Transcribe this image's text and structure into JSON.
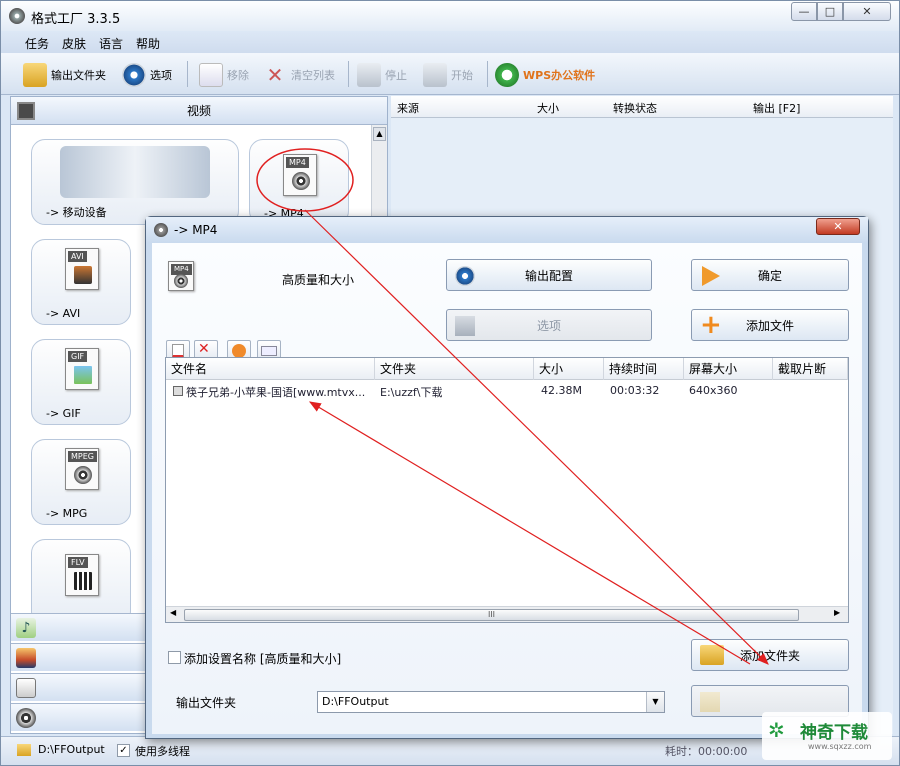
{
  "app": {
    "title": "格式工厂 3.3.5",
    "controls": {
      "minimize": "—",
      "maximize": "□",
      "close": "✕"
    }
  },
  "menu": [
    "任务",
    "皮肤",
    "语言",
    "帮助"
  ],
  "toolbar": {
    "output_folder": "输出文件夹",
    "options": "选项",
    "remove": "移除",
    "clear_list": "清空列表",
    "stop": "停止",
    "start": "开始",
    "wps": "WPS办公软件"
  },
  "sidebar": {
    "category": "视频",
    "tiles": [
      {
        "label": "-> 移动设备",
        "icon": "mobile-devices-icon"
      },
      {
        "label": "-> MP4",
        "tag": "MP4"
      },
      {
        "label": "-> AVI",
        "tag": "AVI"
      },
      {
        "label": "-> GIF",
        "tag": "GIF"
      },
      {
        "label": "-> MPG",
        "tag": "MPEG"
      },
      {
        "label": "",
        "tag": "FLV"
      }
    ],
    "other_categories": [
      "music-note-icon",
      "picture-icon",
      "optical-disc-icon",
      "film-reel-icon"
    ]
  },
  "task_table": {
    "columns": [
      "来源",
      "大小",
      "转换状态",
      "输出 [F2]"
    ]
  },
  "statusbar": {
    "output_path": "D:\\FFOutput",
    "multithread_label": "使用多线程",
    "multithread_checked": true,
    "elapsed_label": "耗时：00:00:00"
  },
  "dialog": {
    "title": "-> MP4",
    "quality": "高质量和大小",
    "output_config": "输出配置",
    "ok": "确定",
    "options": "选项",
    "add_file": "添加文件",
    "add_folder": "添加文件夹",
    "columns": [
      "文件名",
      "文件夹",
      "大小",
      "持续时间",
      "屏幕大小",
      "截取片断"
    ],
    "rows": [
      {
        "name": "筷子兄弟-小苹果-国语[www.mtvx...",
        "folder": "E:\\uzzf\\下载",
        "size": "42.38M",
        "duration": "00:03:32",
        "screen": "640x360",
        "clip": ""
      }
    ],
    "add_setting_name": "添加设置名称 [高质量和大小]",
    "output_folder_label": "输出文件夹",
    "output_folder_value": "D:\\FFOutput",
    "scroll_grip": "III"
  },
  "watermark": {
    "brand": "神奇下载",
    "url": "www.sqxzz.com"
  }
}
